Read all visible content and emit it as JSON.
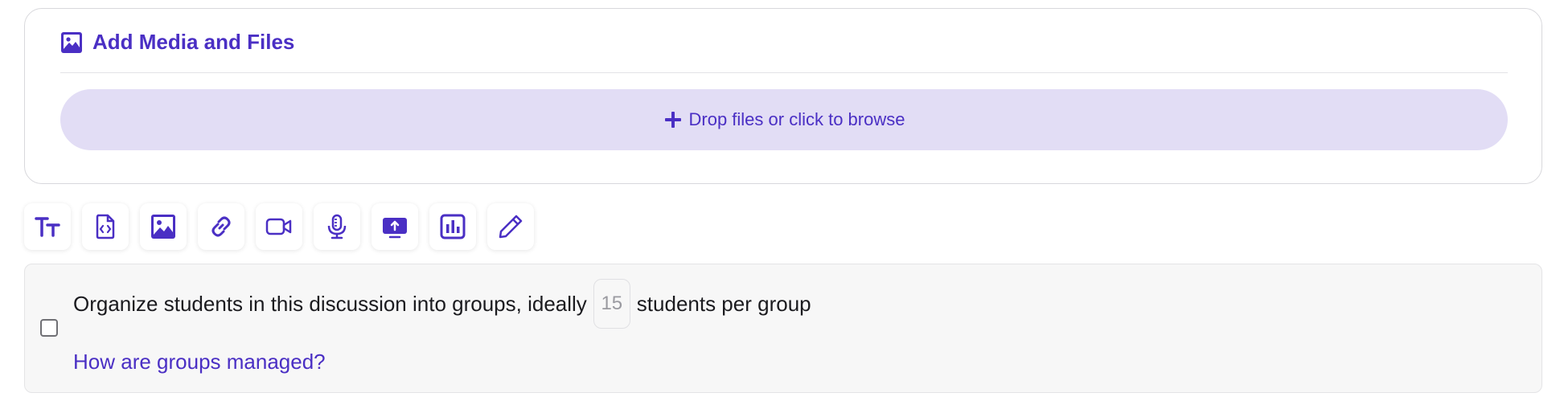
{
  "media": {
    "title": "Add Media and Files",
    "title_icon": "image-icon",
    "drop_label": "Drop files or click to browse",
    "drop_icon": "plus-icon"
  },
  "toolbar": {
    "tools": [
      "text-size-icon",
      "code-file-icon",
      "image-icon",
      "link-icon",
      "video-icon",
      "microphone-icon",
      "screen-upload-icon",
      "chart-icon",
      "pen-icon"
    ]
  },
  "groups": {
    "text_before": "Organize students in this discussion into groups, ideally",
    "size_placeholder": "15",
    "text_after": "students per group",
    "help_link": "How are groups managed?",
    "checked": false
  },
  "colors": {
    "accent": "#4a2fc4",
    "drop_background": "#e2ddf5",
    "panel_background": "#f7f7f7"
  }
}
